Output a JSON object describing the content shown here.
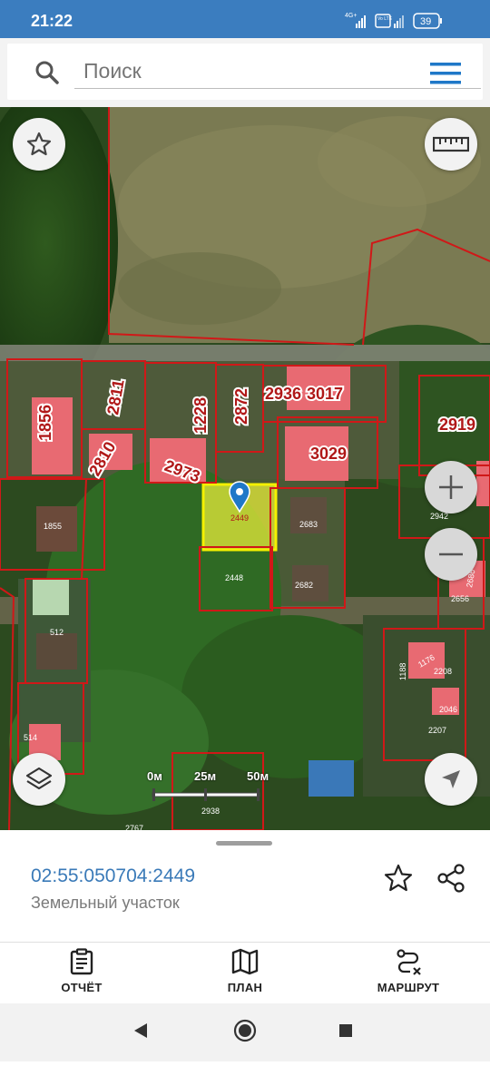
{
  "status_bar": {
    "time": "21:22",
    "signal_tag": "4G+",
    "volte_tag": "Vo LTE",
    "battery": "39"
  },
  "search": {
    "placeholder": "Поиск"
  },
  "map": {
    "parcels_large": [
      {
        "id": "1856",
        "text": "1856"
      },
      {
        "id": "2811",
        "text": "2811"
      },
      {
        "id": "1228",
        "text": "1228"
      },
      {
        "id": "2872",
        "text": "2872"
      },
      {
        "id": "2936",
        "text": "2936"
      },
      {
        "id": "3017",
        "text": "3017"
      },
      {
        "id": "2919",
        "text": "2919"
      },
      {
        "id": "2810",
        "text": "2810"
      },
      {
        "id": "2973",
        "text": "2973"
      },
      {
        "id": "3029",
        "text": "3029"
      }
    ],
    "parcels_small": [
      {
        "id": "1855",
        "text": "1855"
      },
      {
        "id": "2683",
        "text": "2683"
      },
      {
        "id": "2448",
        "text": "2448"
      },
      {
        "id": "2682",
        "text": "2682"
      },
      {
        "id": "2942",
        "text": "2942"
      },
      {
        "id": "2656",
        "text": "2656"
      },
      {
        "id": "2686",
        "text": "2686"
      },
      {
        "id": "512",
        "text": "512"
      },
      {
        "id": "514",
        "text": "514"
      },
      {
        "id": "1188",
        "text": "1188"
      },
      {
        "id": "1176",
        "text": "1176"
      },
      {
        "id": "2208",
        "text": "2208"
      },
      {
        "id": "2046",
        "text": "2046"
      },
      {
        "id": "2207",
        "text": "2207"
      },
      {
        "id": "2938",
        "text": "2938"
      },
      {
        "id": "2767",
        "text": "2767"
      }
    ],
    "selected_parcel": "2449",
    "scale": {
      "label_0": "0м",
      "label_1": "25м",
      "label_2": "50м"
    },
    "colors": {
      "boundary": "#d01818",
      "selected_fill": "#e7ec3a",
      "building": "#e86a72",
      "pin": "#1f78c8"
    }
  },
  "sheet": {
    "cadastral_number": "02:55:050704:2449",
    "object_type": "Земельный участок"
  },
  "bottom_nav": {
    "report_label": "ОТЧЁТ",
    "plan_label": "ПЛАН",
    "route_label": "МАРШРУТ"
  }
}
